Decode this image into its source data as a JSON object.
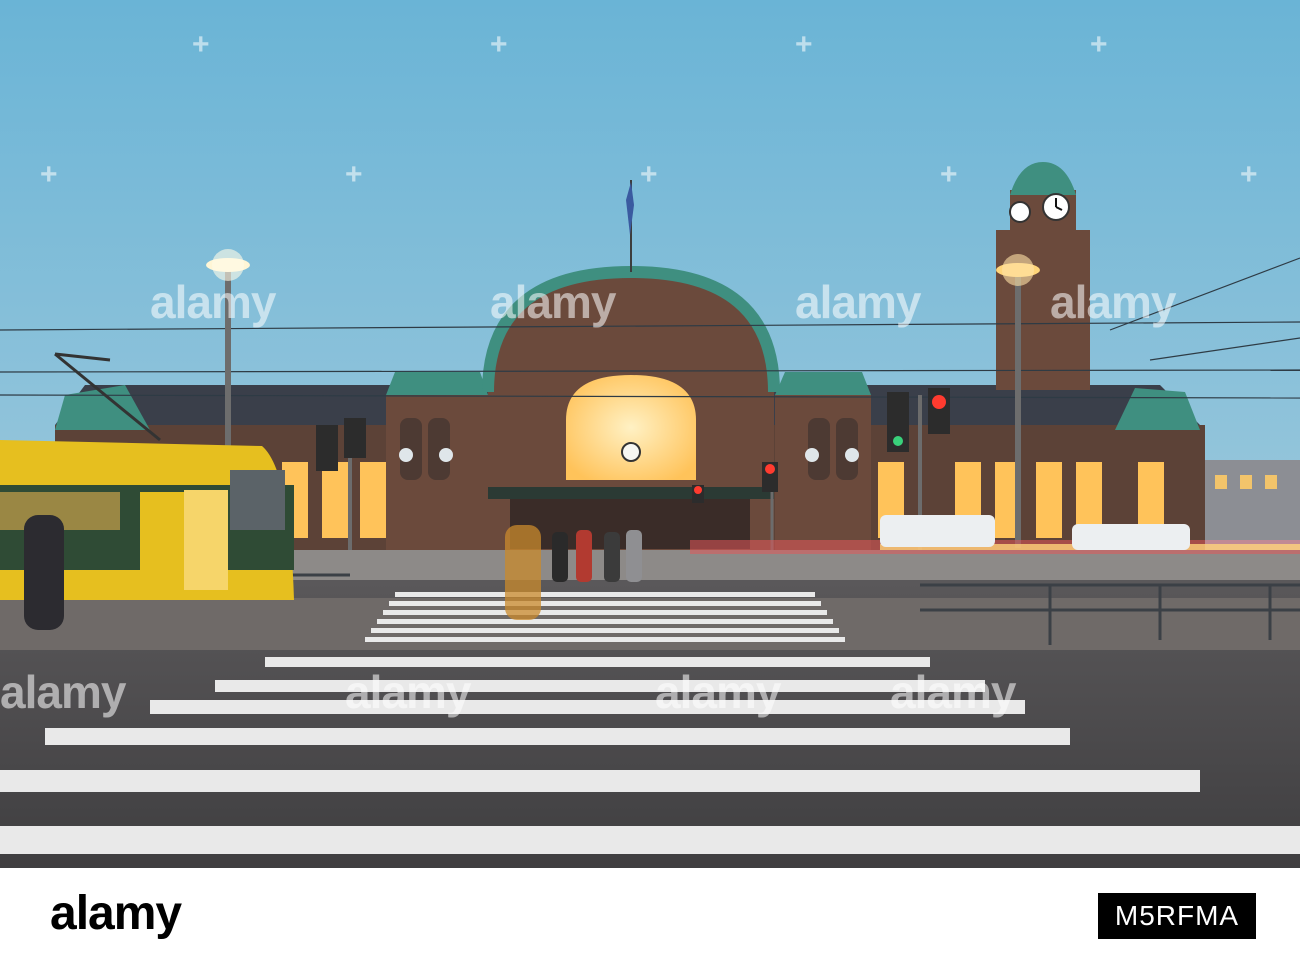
{
  "photo": {
    "sky_top": "#6ab4d6",
    "sky_bottom": "#9ec9dc",
    "stone": "#6b4a3c",
    "copper": "#3f8f80",
    "window_glow": "#ffc35a",
    "tram_yellow": "#e6bf1f",
    "tram_green": "#2f4b35",
    "road": "#4c4b4c",
    "crossing_white": "#e9e9e9"
  },
  "watermark": {
    "word": "alamy",
    "plus_glyph": "+"
  },
  "footer": {
    "brand": "alamy",
    "image_code": "M5RFMA"
  }
}
